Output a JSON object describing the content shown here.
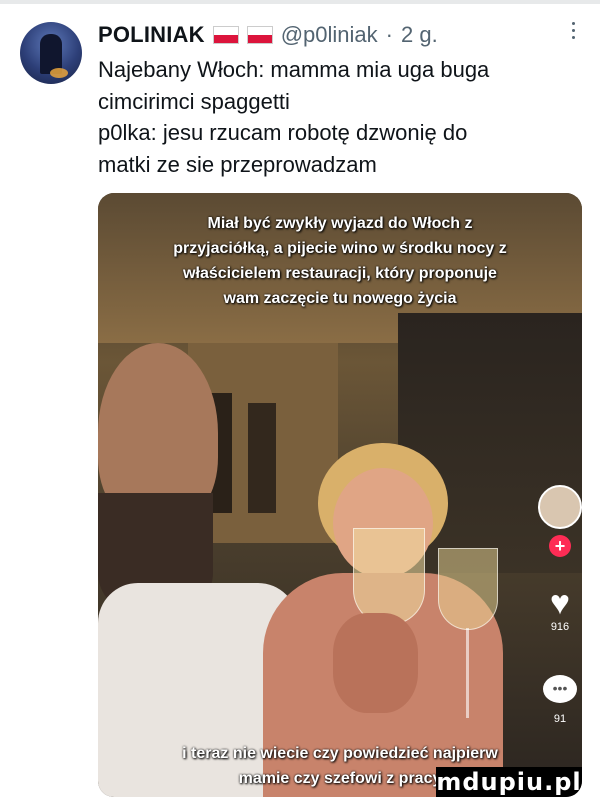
{
  "tweet": {
    "author_name": "POLINIAK",
    "handle": "@p0liniak",
    "separator": "·",
    "timestamp": "2 g.",
    "text": "Najebany Włoch: mamma mia uga buga\ncimcirimci spaggetti\np0lka: jesu rzucam robotę dzwonię do\nmatki ze sie przeprowadzam"
  },
  "media": {
    "caption_top": [
      "Miał być zwykły wyjazd do Włoch z",
      "przyjaciółką, a pijecie wino w środku nocy z",
      "właścicielem restauracji, który proponuje",
      "wam zaczęcie tu nowego życia"
    ],
    "caption_bottom": [
      "i teraz nie wiecie czy powiedzieć najpierw",
      "mamie czy szefowi z pracy"
    ],
    "side_counts": [
      "916",
      "91"
    ],
    "colors": {
      "plus_button": "#fe2c55",
      "flag_red": "#dc143c"
    }
  },
  "watermark": "mdupiu.pl"
}
